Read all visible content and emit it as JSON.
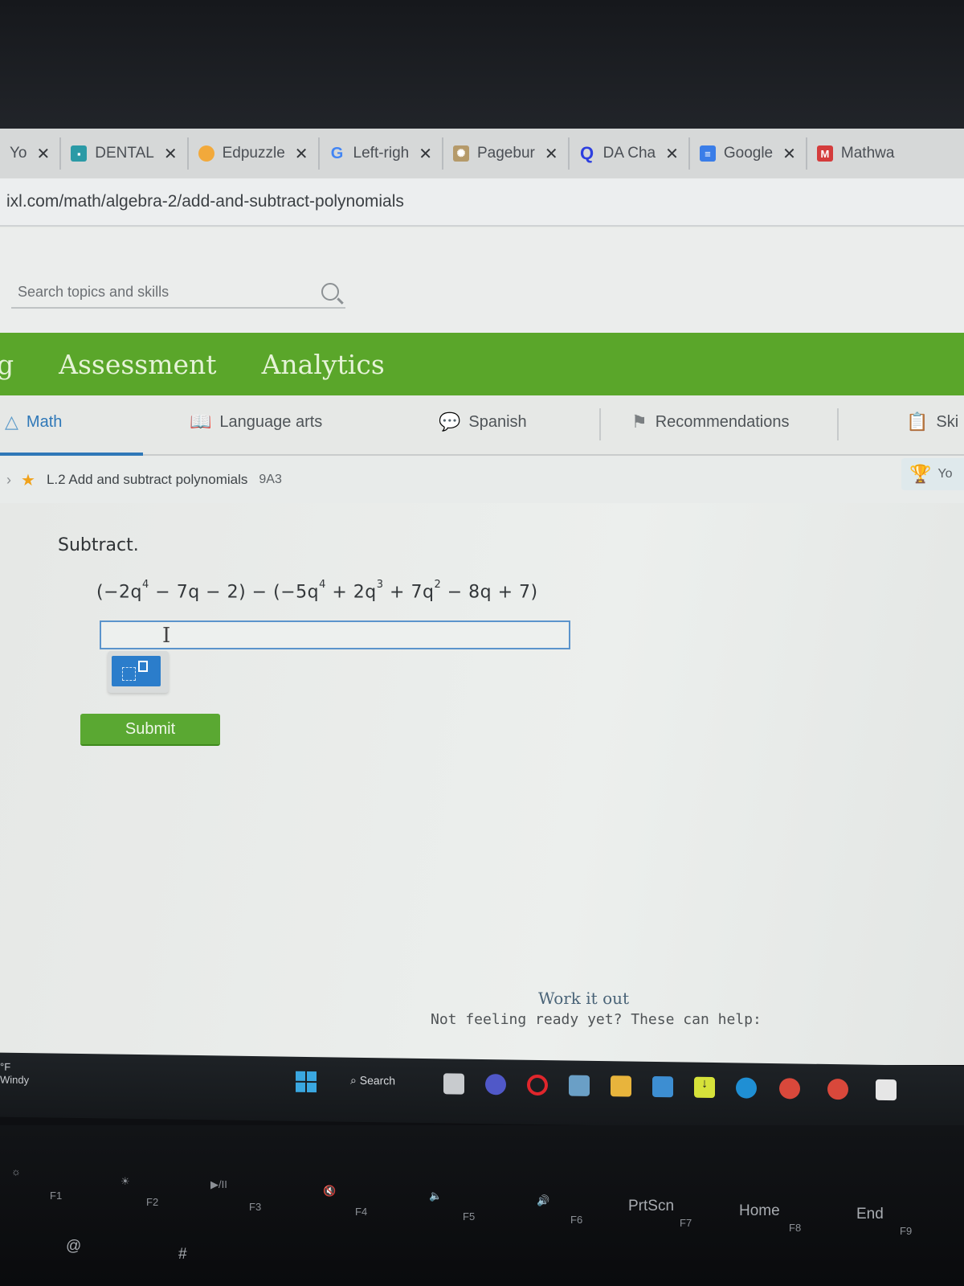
{
  "browser": {
    "tabs": [
      {
        "label": "Yo",
        "icon": "generic-icon",
        "icon_color": "#666666"
      },
      {
        "label": "DENTAL",
        "icon": "classroom-icon",
        "icon_color": "#2b9aa6"
      },
      {
        "label": "Edpuzzle",
        "icon": "edpuzzle-icon",
        "icon_color": "#f2a93b"
      },
      {
        "label": "Left-righ",
        "icon": "google-icon",
        "icon_color": "#4285f4"
      },
      {
        "label": "Pagebur",
        "icon": "pageburst-icon",
        "icon_color": "#b59a6a"
      },
      {
        "label": "DA Cha",
        "icon": "quizlet-icon",
        "icon_color": "#2d3fe0"
      },
      {
        "label": "Google",
        "icon": "google-docs-icon",
        "icon_color": "#3a7de8"
      },
      {
        "label": "Mathwa",
        "icon": "mathway-icon",
        "icon_color": "#d43c3c"
      }
    ],
    "close_glyph": "✕",
    "url": "ixl.com/math/algebra-2/add-and-subtract-polynomials"
  },
  "search": {
    "placeholder": "Search topics and skills"
  },
  "main_nav": {
    "items": [
      "g",
      "Assessment",
      "Analytics"
    ]
  },
  "subjects": {
    "items": [
      "Math",
      "Language arts",
      "Spanish",
      "Recommendations",
      "Ski"
    ],
    "active": "Math"
  },
  "breadcrumb": {
    "skill": "L.2 Add and subtract polynomials",
    "code": "9A3"
  },
  "award": {
    "label": "Yo"
  },
  "question": {
    "instruction": "Subtract.",
    "expression": {
      "first": {
        "terms": [
          {
            "coef": "−2q",
            "exp": "4"
          },
          {
            "op": " − ",
            "coef": "7q"
          },
          {
            "op": " − ",
            "coef": "2"
          }
        ]
      },
      "second": {
        "terms": [
          {
            "coef": "−5q",
            "exp": "4"
          },
          {
            "op": " + ",
            "coef": "2q",
            "exp": "3"
          },
          {
            "op": " + ",
            "coef": "7q",
            "exp": "2"
          },
          {
            "op": " − ",
            "coef": "8q"
          },
          {
            "op": " + ",
            "coef": "7"
          }
        ]
      }
    },
    "answer_value": "",
    "submit_label": "Submit"
  },
  "help": {
    "title": "Work it out",
    "subtitle": "Not feeling ready yet? These can help:"
  },
  "taskbar": {
    "weather_temp": "°F",
    "weather_desc": "Windy",
    "search_label": "Search"
  },
  "keyboard": {
    "keys": [
      "F1",
      "F2",
      "F3",
      "F4",
      "F5",
      "F6",
      "PrtScn",
      "F7",
      "Home",
      "F8",
      "End",
      "F9",
      "@",
      "#"
    ]
  }
}
